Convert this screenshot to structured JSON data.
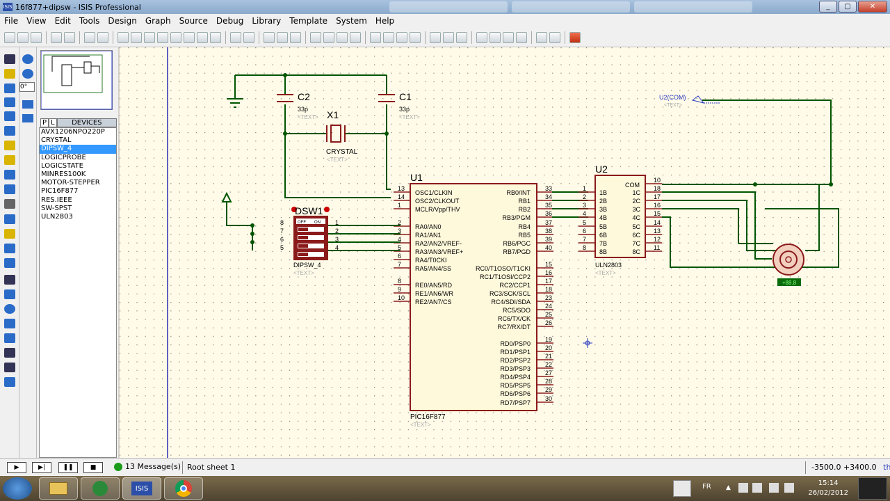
{
  "window": {
    "title": "16f877+dipsw - ISIS Professional",
    "app_badge": "ISIS"
  },
  "menu": [
    "File",
    "View",
    "Edit",
    "Tools",
    "Design",
    "Graph",
    "Source",
    "Debug",
    "Library",
    "Template",
    "System",
    "Help"
  ],
  "rotation": {
    "angle": "0°"
  },
  "device_panel": {
    "tab_p": "P",
    "tab_l": "L",
    "header": "DEVICES",
    "items": [
      "AVX1206NPO220P",
      "CRYSTAL",
      "DIPSW_4",
      "LOGICPROBE",
      "LOGICSTATE",
      "MINRES100K",
      "MOTOR-STEPPER",
      "PIC16F877",
      "RES.IEEE",
      "SW-SPST",
      "ULN2803"
    ],
    "selected": "DIPSW_4"
  },
  "schematic": {
    "c2": {
      "ref": "C2",
      "value": "33p",
      "text": "<TEXT>"
    },
    "c1": {
      "ref": "C1",
      "value": "33p",
      "text": "<TEXT>"
    },
    "x1": {
      "ref": "X1",
      "value": "CRYSTAL",
      "text": "<TEXT>"
    },
    "u1": {
      "ref": "U1",
      "part": "PIC16F877",
      "text": "<TEXT>",
      "left_pins": [
        {
          "num": "13",
          "name": "OSC1/CLKIN"
        },
        {
          "num": "14",
          "name": "OSC2/CLKOUT"
        },
        {
          "num": "1",
          "name": "MCLR/Vpp/THV"
        },
        {
          "num": "2",
          "name": "RA0/AN0"
        },
        {
          "num": "3",
          "name": "RA1/AN1"
        },
        {
          "num": "4",
          "name": "RA2/AN2/VREF-"
        },
        {
          "num": "5",
          "name": "RA3/AN3/VREF+"
        },
        {
          "num": "6",
          "name": "RA4/T0CKI"
        },
        {
          "num": "7",
          "name": "RA5/AN4/SS"
        },
        {
          "num": "8",
          "name": "RE0/AN5/RD"
        },
        {
          "num": "9",
          "name": "RE1/AN6/WR"
        },
        {
          "num": "10",
          "name": "RE2/AN7/CS"
        }
      ],
      "right_pins": [
        {
          "num": "33",
          "name": "RB0/INT"
        },
        {
          "num": "34",
          "name": "RB1"
        },
        {
          "num": "35",
          "name": "RB2"
        },
        {
          "num": "36",
          "name": "RB3/PGM"
        },
        {
          "num": "37",
          "name": "RB4"
        },
        {
          "num": "38",
          "name": "RB5"
        },
        {
          "num": "39",
          "name": "RB6/PGC"
        },
        {
          "num": "40",
          "name": "RB7/PGD"
        },
        {
          "num": "15",
          "name": "RC0/T1OSO/T1CKI"
        },
        {
          "num": "16",
          "name": "RC1/T1OSI/CCP2"
        },
        {
          "num": "17",
          "name": "RC2/CCP1"
        },
        {
          "num": "18",
          "name": "RC3/SCK/SCL"
        },
        {
          "num": "23",
          "name": "RC4/SDI/SDA"
        },
        {
          "num": "24",
          "name": "RC5/SDO"
        },
        {
          "num": "25",
          "name": "RC6/TX/CK"
        },
        {
          "num": "26",
          "name": "RC7/RX/DT"
        },
        {
          "num": "19",
          "name": "RD0/PSP0"
        },
        {
          "num": "20",
          "name": "RD1/PSP1"
        },
        {
          "num": "21",
          "name": "RD2/PSP2"
        },
        {
          "num": "22",
          "name": "RD3/PSP3"
        },
        {
          "num": "27",
          "name": "RD4/PSP4"
        },
        {
          "num": "28",
          "name": "RD5/PSP5"
        },
        {
          "num": "29",
          "name": "RD6/PSP6"
        },
        {
          "num": "30",
          "name": "RD7/PSP7"
        }
      ]
    },
    "dsw1": {
      "ref": "DSW1",
      "part": "DIPSW_4",
      "text": "<TEXT>",
      "off": "OFF",
      "on": "ON",
      "left_nums": [
        "8",
        "7",
        "6",
        "5"
      ],
      "right_nums": [
        "1",
        "2",
        "3",
        "4"
      ]
    },
    "u2": {
      "ref": "U2",
      "part": "ULN2803",
      "text": "<TEXT>",
      "com": "COM",
      "com_pin": "10",
      "inputs": [
        {
          "num": "1",
          "name": "1B"
        },
        {
          "num": "2",
          "name": "2B"
        },
        {
          "num": "3",
          "name": "3B"
        },
        {
          "num": "4",
          "name": "4B"
        },
        {
          "num": "5",
          "name": "5B"
        },
        {
          "num": "6",
          "name": "6B"
        },
        {
          "num": "7",
          "name": "7B"
        },
        {
          "num": "8",
          "name": "8B"
        }
      ],
      "outputs": [
        {
          "num": "18",
          "name": "1C"
        },
        {
          "num": "17",
          "name": "2C"
        },
        {
          "num": "16",
          "name": "3C"
        },
        {
          "num": "15",
          "name": "4C"
        },
        {
          "num": "14",
          "name": "5C"
        },
        {
          "num": "13",
          "name": "6C"
        },
        {
          "num": "12",
          "name": "7C"
        },
        {
          "num": "11",
          "name": "8C"
        }
      ]
    },
    "com_label": {
      "text": "U2(COM)",
      "sub": "<TEXT>"
    },
    "motor": {
      "label": "+88.8"
    }
  },
  "status": {
    "sim_buttons": [
      "▶",
      "▶|",
      "❚❚",
      "■"
    ],
    "messages": "13 Message(s)",
    "sheet": "Root sheet 1",
    "coords": "-3500.0  +3400.0",
    "unit": "th"
  },
  "taskbar": {
    "apps": [
      "explorer",
      "gear",
      "ISIS",
      "chrome"
    ],
    "lang": "FR",
    "time": "15:14",
    "date": "26/02/2012"
  },
  "colors": {
    "wire": "#005500",
    "component": "#8b1a1a",
    "canvas": "#fffbe8",
    "selection": "#3399ff"
  }
}
